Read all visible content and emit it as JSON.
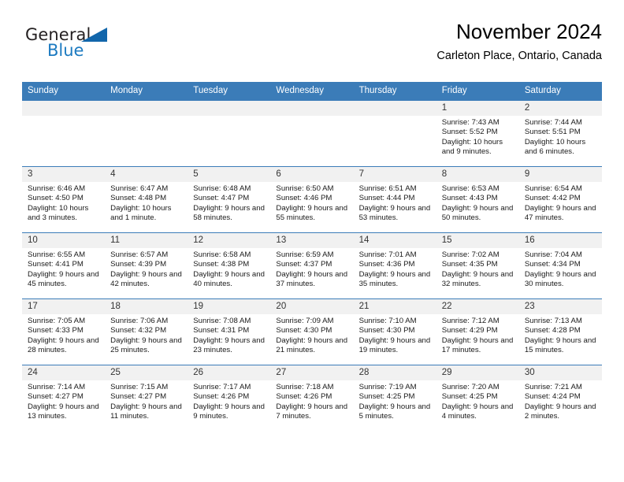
{
  "brand": {
    "name_top": "General",
    "name_bottom": "Blue",
    "accent_color": "#1c7ac0",
    "triangle_color": "#1266ab"
  },
  "header": {
    "title": "November 2024",
    "subtitle": "Carleton Place, Ontario, Canada"
  },
  "theme": {
    "header_bg": "#3b7cb8",
    "daynum_bg": "#f1f1f1",
    "grid_line": "#3b7cb8"
  },
  "weekdays": [
    "Sunday",
    "Monday",
    "Tuesday",
    "Wednesday",
    "Thursday",
    "Friday",
    "Saturday"
  ],
  "labels": {
    "sunrise": "Sunrise:",
    "sunset": "Sunset:",
    "daylight": "Daylight:"
  },
  "weeks": [
    [
      {
        "day": "",
        "empty": true
      },
      {
        "day": "",
        "empty": true
      },
      {
        "day": "",
        "empty": true
      },
      {
        "day": "",
        "empty": true
      },
      {
        "day": "",
        "empty": true
      },
      {
        "day": "1",
        "sunrise": "Sunrise: 7:43 AM",
        "sunset": "Sunset: 5:52 PM",
        "daylight": "Daylight: 10 hours and 9 minutes."
      },
      {
        "day": "2",
        "sunrise": "Sunrise: 7:44 AM",
        "sunset": "Sunset: 5:51 PM",
        "daylight": "Daylight: 10 hours and 6 minutes."
      }
    ],
    [
      {
        "day": "3",
        "sunrise": "Sunrise: 6:46 AM",
        "sunset": "Sunset: 4:50 PM",
        "daylight": "Daylight: 10 hours and 3 minutes."
      },
      {
        "day": "4",
        "sunrise": "Sunrise: 6:47 AM",
        "sunset": "Sunset: 4:48 PM",
        "daylight": "Daylight: 10 hours and 1 minute."
      },
      {
        "day": "5",
        "sunrise": "Sunrise: 6:48 AM",
        "sunset": "Sunset: 4:47 PM",
        "daylight": "Daylight: 9 hours and 58 minutes."
      },
      {
        "day": "6",
        "sunrise": "Sunrise: 6:50 AM",
        "sunset": "Sunset: 4:46 PM",
        "daylight": "Daylight: 9 hours and 55 minutes."
      },
      {
        "day": "7",
        "sunrise": "Sunrise: 6:51 AM",
        "sunset": "Sunset: 4:44 PM",
        "daylight": "Daylight: 9 hours and 53 minutes."
      },
      {
        "day": "8",
        "sunrise": "Sunrise: 6:53 AM",
        "sunset": "Sunset: 4:43 PM",
        "daylight": "Daylight: 9 hours and 50 minutes."
      },
      {
        "day": "9",
        "sunrise": "Sunrise: 6:54 AM",
        "sunset": "Sunset: 4:42 PM",
        "daylight": "Daylight: 9 hours and 47 minutes."
      }
    ],
    [
      {
        "day": "10",
        "sunrise": "Sunrise: 6:55 AM",
        "sunset": "Sunset: 4:41 PM",
        "daylight": "Daylight: 9 hours and 45 minutes."
      },
      {
        "day": "11",
        "sunrise": "Sunrise: 6:57 AM",
        "sunset": "Sunset: 4:39 PM",
        "daylight": "Daylight: 9 hours and 42 minutes."
      },
      {
        "day": "12",
        "sunrise": "Sunrise: 6:58 AM",
        "sunset": "Sunset: 4:38 PM",
        "daylight": "Daylight: 9 hours and 40 minutes."
      },
      {
        "day": "13",
        "sunrise": "Sunrise: 6:59 AM",
        "sunset": "Sunset: 4:37 PM",
        "daylight": "Daylight: 9 hours and 37 minutes."
      },
      {
        "day": "14",
        "sunrise": "Sunrise: 7:01 AM",
        "sunset": "Sunset: 4:36 PM",
        "daylight": "Daylight: 9 hours and 35 minutes."
      },
      {
        "day": "15",
        "sunrise": "Sunrise: 7:02 AM",
        "sunset": "Sunset: 4:35 PM",
        "daylight": "Daylight: 9 hours and 32 minutes."
      },
      {
        "day": "16",
        "sunrise": "Sunrise: 7:04 AM",
        "sunset": "Sunset: 4:34 PM",
        "daylight": "Daylight: 9 hours and 30 minutes."
      }
    ],
    [
      {
        "day": "17",
        "sunrise": "Sunrise: 7:05 AM",
        "sunset": "Sunset: 4:33 PM",
        "daylight": "Daylight: 9 hours and 28 minutes."
      },
      {
        "day": "18",
        "sunrise": "Sunrise: 7:06 AM",
        "sunset": "Sunset: 4:32 PM",
        "daylight": "Daylight: 9 hours and 25 minutes."
      },
      {
        "day": "19",
        "sunrise": "Sunrise: 7:08 AM",
        "sunset": "Sunset: 4:31 PM",
        "daylight": "Daylight: 9 hours and 23 minutes."
      },
      {
        "day": "20",
        "sunrise": "Sunrise: 7:09 AM",
        "sunset": "Sunset: 4:30 PM",
        "daylight": "Daylight: 9 hours and 21 minutes."
      },
      {
        "day": "21",
        "sunrise": "Sunrise: 7:10 AM",
        "sunset": "Sunset: 4:30 PM",
        "daylight": "Daylight: 9 hours and 19 minutes."
      },
      {
        "day": "22",
        "sunrise": "Sunrise: 7:12 AM",
        "sunset": "Sunset: 4:29 PM",
        "daylight": "Daylight: 9 hours and 17 minutes."
      },
      {
        "day": "23",
        "sunrise": "Sunrise: 7:13 AM",
        "sunset": "Sunset: 4:28 PM",
        "daylight": "Daylight: 9 hours and 15 minutes."
      }
    ],
    [
      {
        "day": "24",
        "sunrise": "Sunrise: 7:14 AM",
        "sunset": "Sunset: 4:27 PM",
        "daylight": "Daylight: 9 hours and 13 minutes."
      },
      {
        "day": "25",
        "sunrise": "Sunrise: 7:15 AM",
        "sunset": "Sunset: 4:27 PM",
        "daylight": "Daylight: 9 hours and 11 minutes."
      },
      {
        "day": "26",
        "sunrise": "Sunrise: 7:17 AM",
        "sunset": "Sunset: 4:26 PM",
        "daylight": "Daylight: 9 hours and 9 minutes."
      },
      {
        "day": "27",
        "sunrise": "Sunrise: 7:18 AM",
        "sunset": "Sunset: 4:26 PM",
        "daylight": "Daylight: 9 hours and 7 minutes."
      },
      {
        "day": "28",
        "sunrise": "Sunrise: 7:19 AM",
        "sunset": "Sunset: 4:25 PM",
        "daylight": "Daylight: 9 hours and 5 minutes."
      },
      {
        "day": "29",
        "sunrise": "Sunrise: 7:20 AM",
        "sunset": "Sunset: 4:25 PM",
        "daylight": "Daylight: 9 hours and 4 minutes."
      },
      {
        "day": "30",
        "sunrise": "Sunrise: 7:21 AM",
        "sunset": "Sunset: 4:24 PM",
        "daylight": "Daylight: 9 hours and 2 minutes."
      }
    ]
  ]
}
